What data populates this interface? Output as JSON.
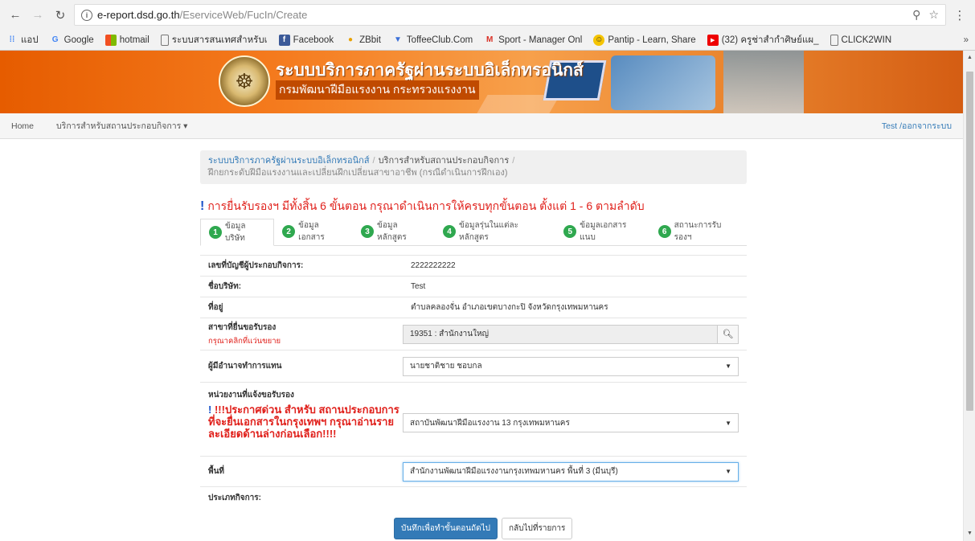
{
  "browser": {
    "url_host": "e-report.dsd.go.th",
    "url_path": "/EserviceWeb/FucIn/Create",
    "bookmarks": [
      {
        "icon": "apps-icon",
        "label": "แอป"
      },
      {
        "icon": "google-icon",
        "label": "Google"
      },
      {
        "icon": "windows-icon",
        "label": "hotmail"
      },
      {
        "icon": "page-icon",
        "label": "ระบบสารสนเทศสำหรับเ"
      },
      {
        "icon": "facebook-icon",
        "label": "Facebook"
      },
      {
        "icon": "zbbit-icon",
        "label": "ZBbit"
      },
      {
        "icon": "toffee-icon",
        "label": "ToffeeClub.Com"
      },
      {
        "icon": "gmail-icon",
        "label": "Sport - Manager Onl"
      },
      {
        "icon": "pantip-icon",
        "label": "Pantip - Learn, Share"
      },
      {
        "icon": "youtube-icon",
        "label": "(32) ครูช่าสำกำศิษย์แผ_"
      },
      {
        "icon": "page-icon",
        "label": "CLICK2WIN"
      }
    ]
  },
  "banner": {
    "title": "ระบบบริการภาครัฐผ่านระบบอิเล็กทรอนิกส์",
    "subtitle": "กรมพัฒนาฝีมือแรงงาน กระทรวงแรงงาน"
  },
  "navbar": {
    "home": "Home",
    "services": "บริการสำหรับสถานประกอบกิจการ ▾",
    "user": "Test /ออกจากระบบ"
  },
  "breadcrumb": {
    "level1": "ระบบบริการภาครัฐผ่านระบบอิเล็กทรอนิกส์",
    "level2": "บริการสำหรับสถานประกอบกิจการ",
    "level3": "ฝึกยกระดับฝีมือแรงงานและเปลี่ยนฝึกเปลี่ยนสาขาอาชีพ (กรณีดำเนินการฝึกเอง)"
  },
  "notice": "การยื่นรับรองฯ มีทั้งสิ้น 6 ขั้นตอน กรุณาดำเนินการให้ครบทุกขั้นตอน ตั้งแต่ 1 - 6 ตามลำดับ",
  "tabs": [
    {
      "num": "1",
      "label": "ข้อมูลบริษัท"
    },
    {
      "num": "2",
      "label": "ข้อมูลเอกสาร"
    },
    {
      "num": "3",
      "label": "ข้อมูลหลักสูตร"
    },
    {
      "num": "4",
      "label": "ข้อมูลรุ่นในแต่ละหลักสูตร"
    },
    {
      "num": "5",
      "label": "ข้อมูลเอกสารแนบ"
    },
    {
      "num": "6",
      "label": "สถานะการรับรองฯ"
    }
  ],
  "form": {
    "account_label": "เลขที่บัญชีผู้ประกอบกิจการ:",
    "account_value": "2222222222",
    "company_label": "ชื่อบริษัท:",
    "company_value": "Test",
    "address_label": "ที่อยู่",
    "address_value": "ตำบลคลองจั่น อำเภอเขตบางกะปิ จังหวัดกรุงเทพมหานคร",
    "branch_label": "สาขาที่ยื่นขอรับรอง",
    "branch_hint": "กรุณาคลิกที่แว่นขยาย",
    "branch_value": "19351 : สำนักงานใหญ่",
    "authority_label": "ผู้มีอำนาจทำการแทน",
    "authority_value": "นายชาติชาย ชอบกล",
    "agency_label": "หน่วยงานที่แจ้งขอรับรอง",
    "agency_warning": "!!!ประกาศด่วน สำหรับ สถานประกอบการที่จะยื่นเอกสารในกรุงเทพฯ กรุณาอ่านรายละเอียดด้านล่างก่อนเลือก!!!!",
    "agency_value": "สถาบันพัฒนาฝีมือแรงงาน 13 กรุงเทพมหานคร",
    "area_label": "พื้นที่",
    "area_value": "สำนักงานพัฒนาฝีมือแรงงานกรุงเทพมหานคร พื้นที่ 3 (มีนบุรี)",
    "business_type_label": "ประเภทกิจการ:"
  },
  "actions": {
    "save_next": "บันทึกเพื่อทำขั้นตอนถัดไป",
    "back": "กลับไปที่รายการ"
  }
}
